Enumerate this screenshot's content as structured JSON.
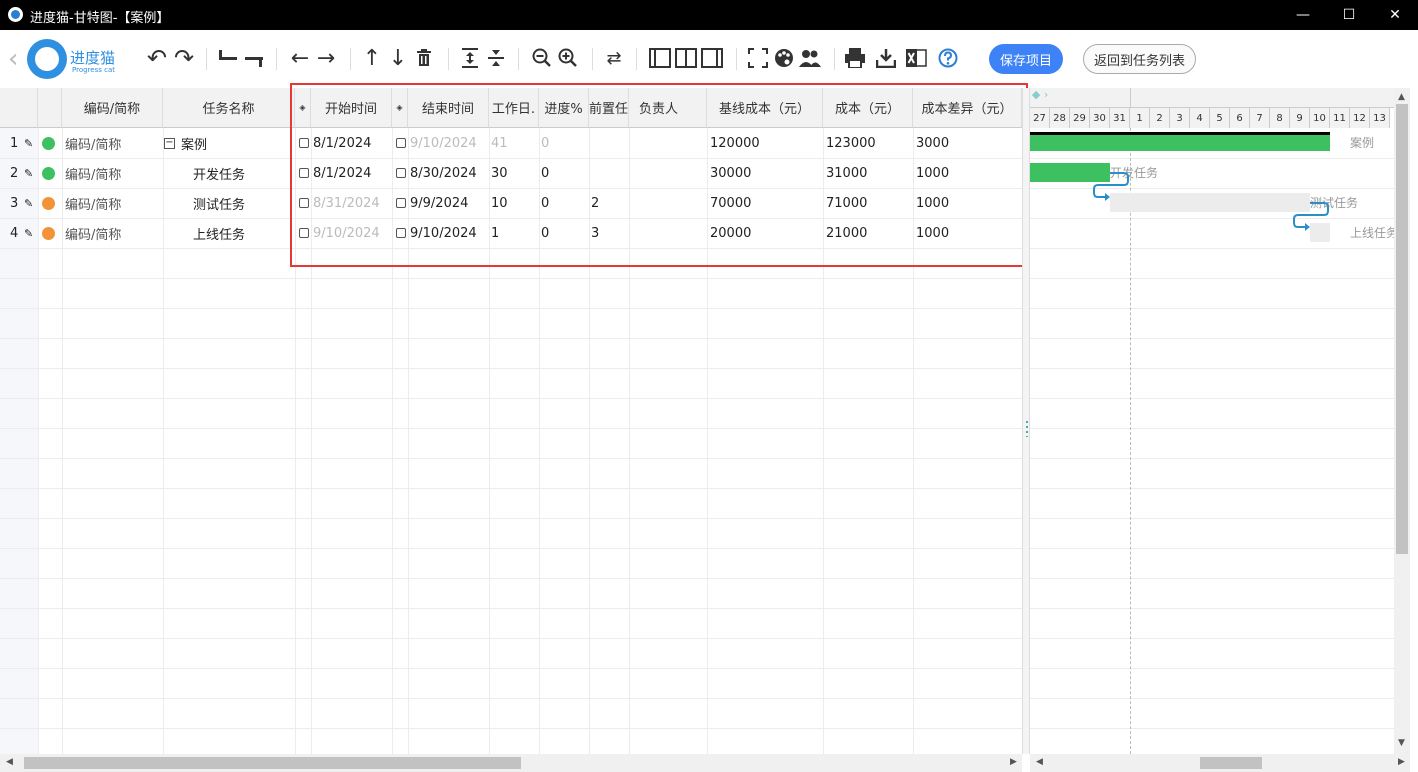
{
  "window": {
    "title": "进度猫-甘特图-【案例】",
    "minimize": "—",
    "maximize": "☐",
    "close": "✕"
  },
  "logo": {
    "cn": "进度猫",
    "en": "Progress cat"
  },
  "toolbar": {
    "save_label": "保存项目",
    "back_label": "返回到任务列表"
  },
  "columns": {
    "code": "编码/简称",
    "name": "任务名称",
    "start": "开始时间",
    "end": "结束时间",
    "workdays": "工作日.",
    "progress": "进度%",
    "pred": "前置任",
    "owner": "负责人",
    "baseline": "基线成本（元）",
    "cost": "成本（元）",
    "variance": "成本差异（元）"
  },
  "rows": [
    {
      "num": "1",
      "code": "编码/简称",
      "name": "案例",
      "start": "8/1/2024",
      "end": "9/10/2024",
      "workdays": "41",
      "progress": "0",
      "pred": "",
      "owner": "",
      "baseline": "120000",
      "cost": "123000",
      "variance": "3000",
      "dot": "#3cc060"
    },
    {
      "num": "2",
      "code": "编码/简称",
      "name": "开发任务",
      "start": "8/1/2024",
      "end": "8/30/2024",
      "workdays": "30",
      "progress": "0",
      "pred": "",
      "owner": "",
      "baseline": "30000",
      "cost": "31000",
      "variance": "1000",
      "dot": "#3cc060"
    },
    {
      "num": "3",
      "code": "编码/简称",
      "name": "测试任务",
      "start": "8/31/2024",
      "end": "9/9/2024",
      "workdays": "10",
      "progress": "0",
      "pred": "2",
      "owner": "",
      "baseline": "70000",
      "cost": "71000",
      "variance": "1000",
      "dot": "#f39237"
    },
    {
      "num": "4",
      "code": "编码/简称",
      "name": "上线任务",
      "start": "9/10/2024",
      "end": "9/10/2024",
      "workdays": "1",
      "progress": "0",
      "pred": "3",
      "owner": "",
      "baseline": "20000",
      "cost": "21000",
      "variance": "1000",
      "dot": "#f39237"
    }
  ],
  "gantt": {
    "days": [
      "27",
      "28",
      "29",
      "30",
      "31",
      "1",
      "2",
      "3",
      "4",
      "5",
      "6",
      "7",
      "8",
      "9",
      "10",
      "11",
      "12",
      "13"
    ],
    "bar_labels": [
      "案例",
      "开发任务",
      "测试任务",
      "上线任务"
    ],
    "colors": {
      "bar": "#3cc060",
      "planned": "#ececec",
      "link": "#2a8fc9"
    }
  }
}
